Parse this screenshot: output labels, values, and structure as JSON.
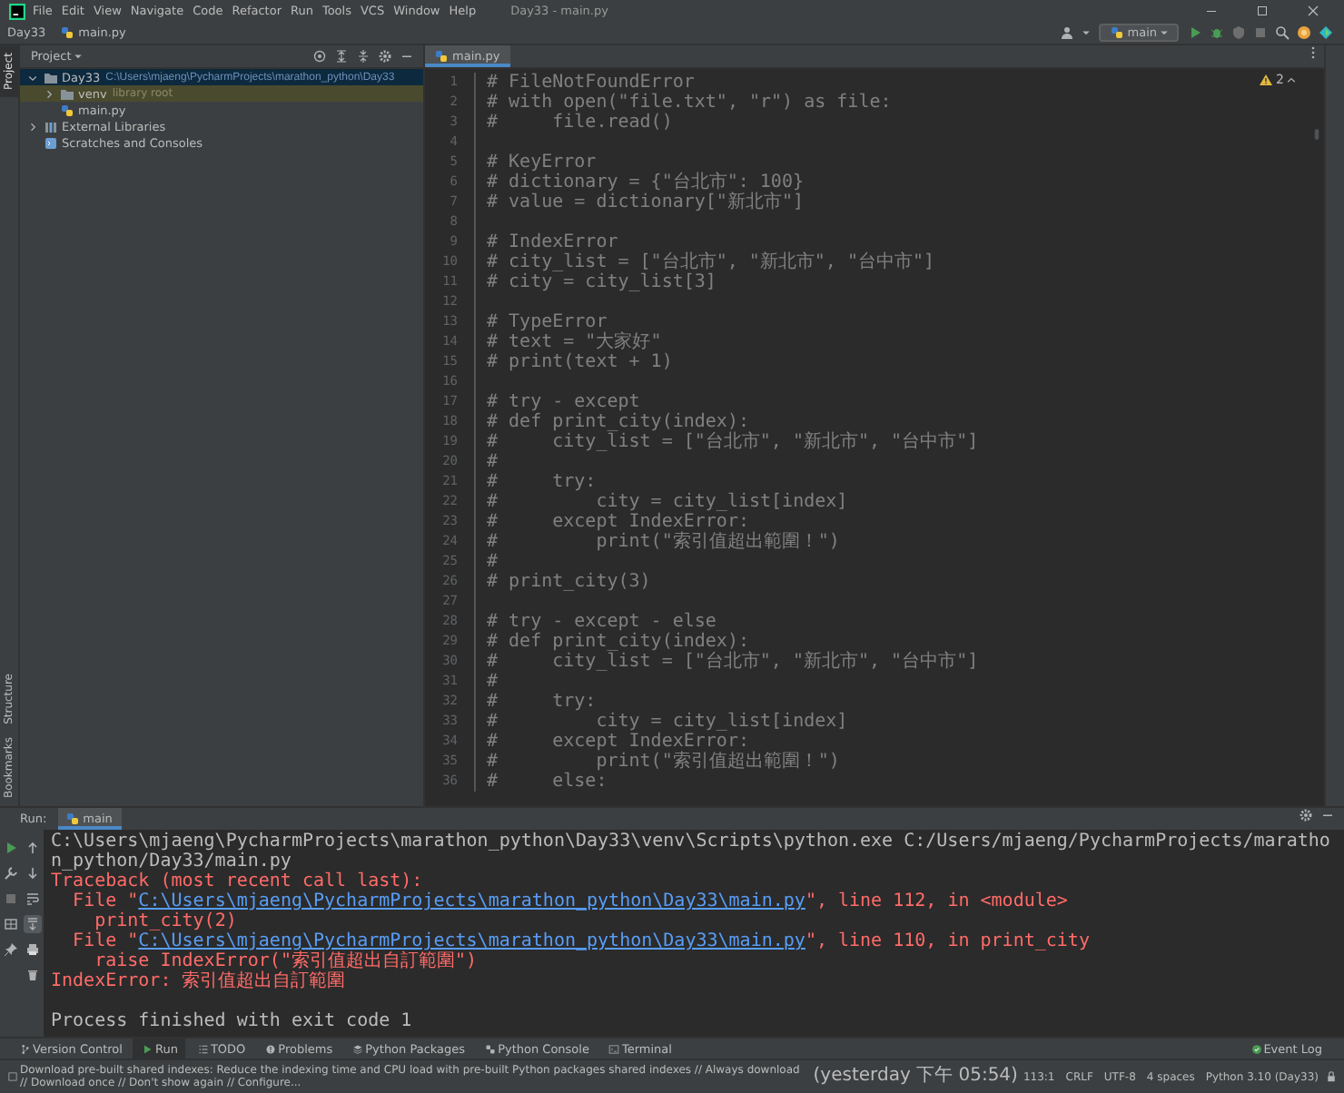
{
  "menu_bar": {
    "items": [
      "File",
      "Edit",
      "View",
      "Navigate",
      "Code",
      "Refactor",
      "Run",
      "Tools",
      "VCS",
      "Window",
      "Help"
    ],
    "title": "Day33 - main.py"
  },
  "nav_bar": {
    "crumbs": [
      {
        "kind": "folder",
        "label": "Day33"
      },
      {
        "kind": "python-file",
        "label": "main.py"
      }
    ],
    "run_config": "main",
    "tools": [
      {
        "kind": "run"
      },
      {
        "kind": "debug"
      },
      {
        "kind": "coverage"
      },
      {
        "kind": "stop"
      },
      {
        "kind": "search"
      },
      {
        "kind": "update"
      },
      {
        "kind": "plugin"
      }
    ]
  },
  "side_strip": {
    "top": [
      {
        "label": "Project",
        "selected": true
      }
    ],
    "bottom": [
      {
        "label": "Structure"
      },
      {
        "label": "Bookmarks"
      }
    ]
  },
  "project": {
    "title": "Project",
    "tree": [
      {
        "name": "Day33",
        "kind": "folder",
        "path": "C:\\Users\\mjaeng\\PycharmProjects\\marathon_python\\Day33",
        "expanded": true,
        "selected": true,
        "children": [
          {
            "name": "venv",
            "kind": "root-folder",
            "note": "library root",
            "expanded": false,
            "selected": false
          },
          {
            "name": "main.py",
            "kind": "python-file",
            "selected": false
          }
        ]
      },
      {
        "name": "External Libraries",
        "kind": "library",
        "expanded": false,
        "selected": false
      },
      {
        "name": "Scratches and Consoles",
        "kind": "scratches",
        "selected": false
      }
    ]
  },
  "editor": {
    "tabs": [
      {
        "label": "main.py",
        "selected": true
      }
    ],
    "warnings": "2",
    "lines": [
      {
        "number": "1",
        "text": "# FileNotFoundError"
      },
      {
        "number": "2",
        "text": "# with open(\"file.txt\", \"r\") as file:"
      },
      {
        "number": "3",
        "text": "#     file.read()"
      },
      {
        "number": "4"
      },
      {
        "number": "5",
        "text": "# KeyError"
      },
      {
        "number": "6",
        "text": "# dictionary = {\"台北市\": 100}"
      },
      {
        "number": "7",
        "text": "# value = dictionary[\"新北市\"]"
      },
      {
        "number": "8"
      },
      {
        "number": "9",
        "text": "# IndexError"
      },
      {
        "number": "10",
        "text": "# city_list = [\"台北市\", \"新北市\", \"台中市\"]"
      },
      {
        "number": "11",
        "text": "# city = city_list[3]"
      },
      {
        "number": "12"
      },
      {
        "number": "13",
        "text": "# TypeError"
      },
      {
        "number": "14",
        "text": "# text = \"大家好\""
      },
      {
        "number": "15",
        "text": "# print(text + 1)"
      },
      {
        "number": "16"
      },
      {
        "number": "17",
        "text": "# try - except"
      },
      {
        "number": "18",
        "text": "# def print_city(index):"
      },
      {
        "number": "19",
        "text": "#     city_list = [\"台北市\", \"新北市\", \"台中市\"]"
      },
      {
        "number": "20",
        "text": "#"
      },
      {
        "number": "21",
        "text": "#     try:"
      },
      {
        "number": "22",
        "text": "#         city = city_list[index]"
      },
      {
        "number": "23",
        "text": "#     except IndexError:"
      },
      {
        "number": "24",
        "text": "#         print(\"索引值超出範圍！\")"
      },
      {
        "number": "25",
        "text": "#"
      },
      {
        "number": "26",
        "text": "# print_city(3)"
      },
      {
        "number": "27"
      },
      {
        "number": "28",
        "text": "# try - except - else"
      },
      {
        "number": "29",
        "text": "# def print_city(index):"
      },
      {
        "number": "30",
        "text": "#     city_list = [\"台北市\", \"新北市\", \"台中市\"]"
      },
      {
        "number": "31",
        "text": "#"
      },
      {
        "number": "32",
        "text": "#     try:"
      },
      {
        "number": "33",
        "text": "#         city = city_list[index]"
      },
      {
        "number": "34",
        "text": "#     except IndexError:"
      },
      {
        "number": "35",
        "text": "#         print(\"索引值超出範圍！\")"
      },
      {
        "number": "36",
        "text": "#     else:"
      }
    ]
  },
  "run": {
    "title": "Run:",
    "tabs": [
      {
        "label": "main",
        "selected": true
      }
    ],
    "left_tools": [
      {
        "kind": "run"
      },
      {
        "kind": "wrench"
      },
      {
        "kind": "stop"
      },
      {
        "kind": "layout"
      },
      {
        "kind": "pin"
      }
    ],
    "right_tools": [
      {
        "kind": "up",
        "on": false
      },
      {
        "kind": "down",
        "on": false
      },
      {
        "kind": "wrap",
        "on": false
      },
      {
        "kind": "scroll-end",
        "on": true
      },
      {
        "kind": "print",
        "on": false
      },
      {
        "kind": "trash",
        "on": false
      }
    ],
    "console": [
      {
        "kind": "command",
        "text": "C:\\Users\\mjaeng\\PycharmProjects\\marathon_python\\Day33\\venv\\Scripts\\python.exe C:/Users/mjaeng/PycharmProjects/marathon_python/Day33/main.py"
      },
      {
        "kind": "error",
        "text": "Traceback (most recent call last):"
      },
      {
        "kind": "file",
        "prefix": "  File \"",
        "link": "C:\\Users\\mjaeng\\PycharmProjects\\marathon_python\\Day33\\main.py",
        "suffix": "\", line 112, in <module>"
      },
      {
        "kind": "error",
        "text": "    print_city(2)"
      },
      {
        "kind": "file",
        "prefix": "  File \"",
        "link": "C:\\Users\\mjaeng\\PycharmProjects\\marathon_python\\Day33\\main.py",
        "suffix": "\", line 110, in print_city"
      },
      {
        "kind": "error",
        "text": "    raise IndexError(\"索引值超出自訂範圍\")"
      },
      {
        "kind": "error",
        "text": "IndexError: 索引值超出自訂範圍"
      },
      {
        "kind": "blank"
      },
      {
        "kind": "output",
        "text": "Process finished with exit code 1"
      }
    ]
  },
  "tool_windows": {
    "items": [
      {
        "label": "Version Control",
        "kind": "vcs",
        "selected": false
      },
      {
        "label": "Run",
        "kind": "run",
        "selected": true
      },
      {
        "label": "TODO",
        "kind": "todo",
        "selected": false
      },
      {
        "label": "Problems",
        "kind": "problems",
        "selected": false
      },
      {
        "label": "Python Packages",
        "kind": "packages",
        "selected": false
      },
      {
        "label": "Python Console",
        "kind": "console",
        "selected": false
      },
      {
        "label": "Terminal",
        "kind": "terminal",
        "selected": false
      }
    ],
    "event_log": "Event Log"
  },
  "status_bar": {
    "message": "Download pre-built shared indexes: Reduce the indexing time and CPU load with pre-built Python packages shared indexes // Always download // Download once // Don't show again // Configure...",
    "time": "(yesterday 下午 05:54)",
    "items": [
      "113:1",
      "CRLF",
      "UTF-8",
      "4 spaces",
      "Python 3.10 (Day33)"
    ]
  }
}
